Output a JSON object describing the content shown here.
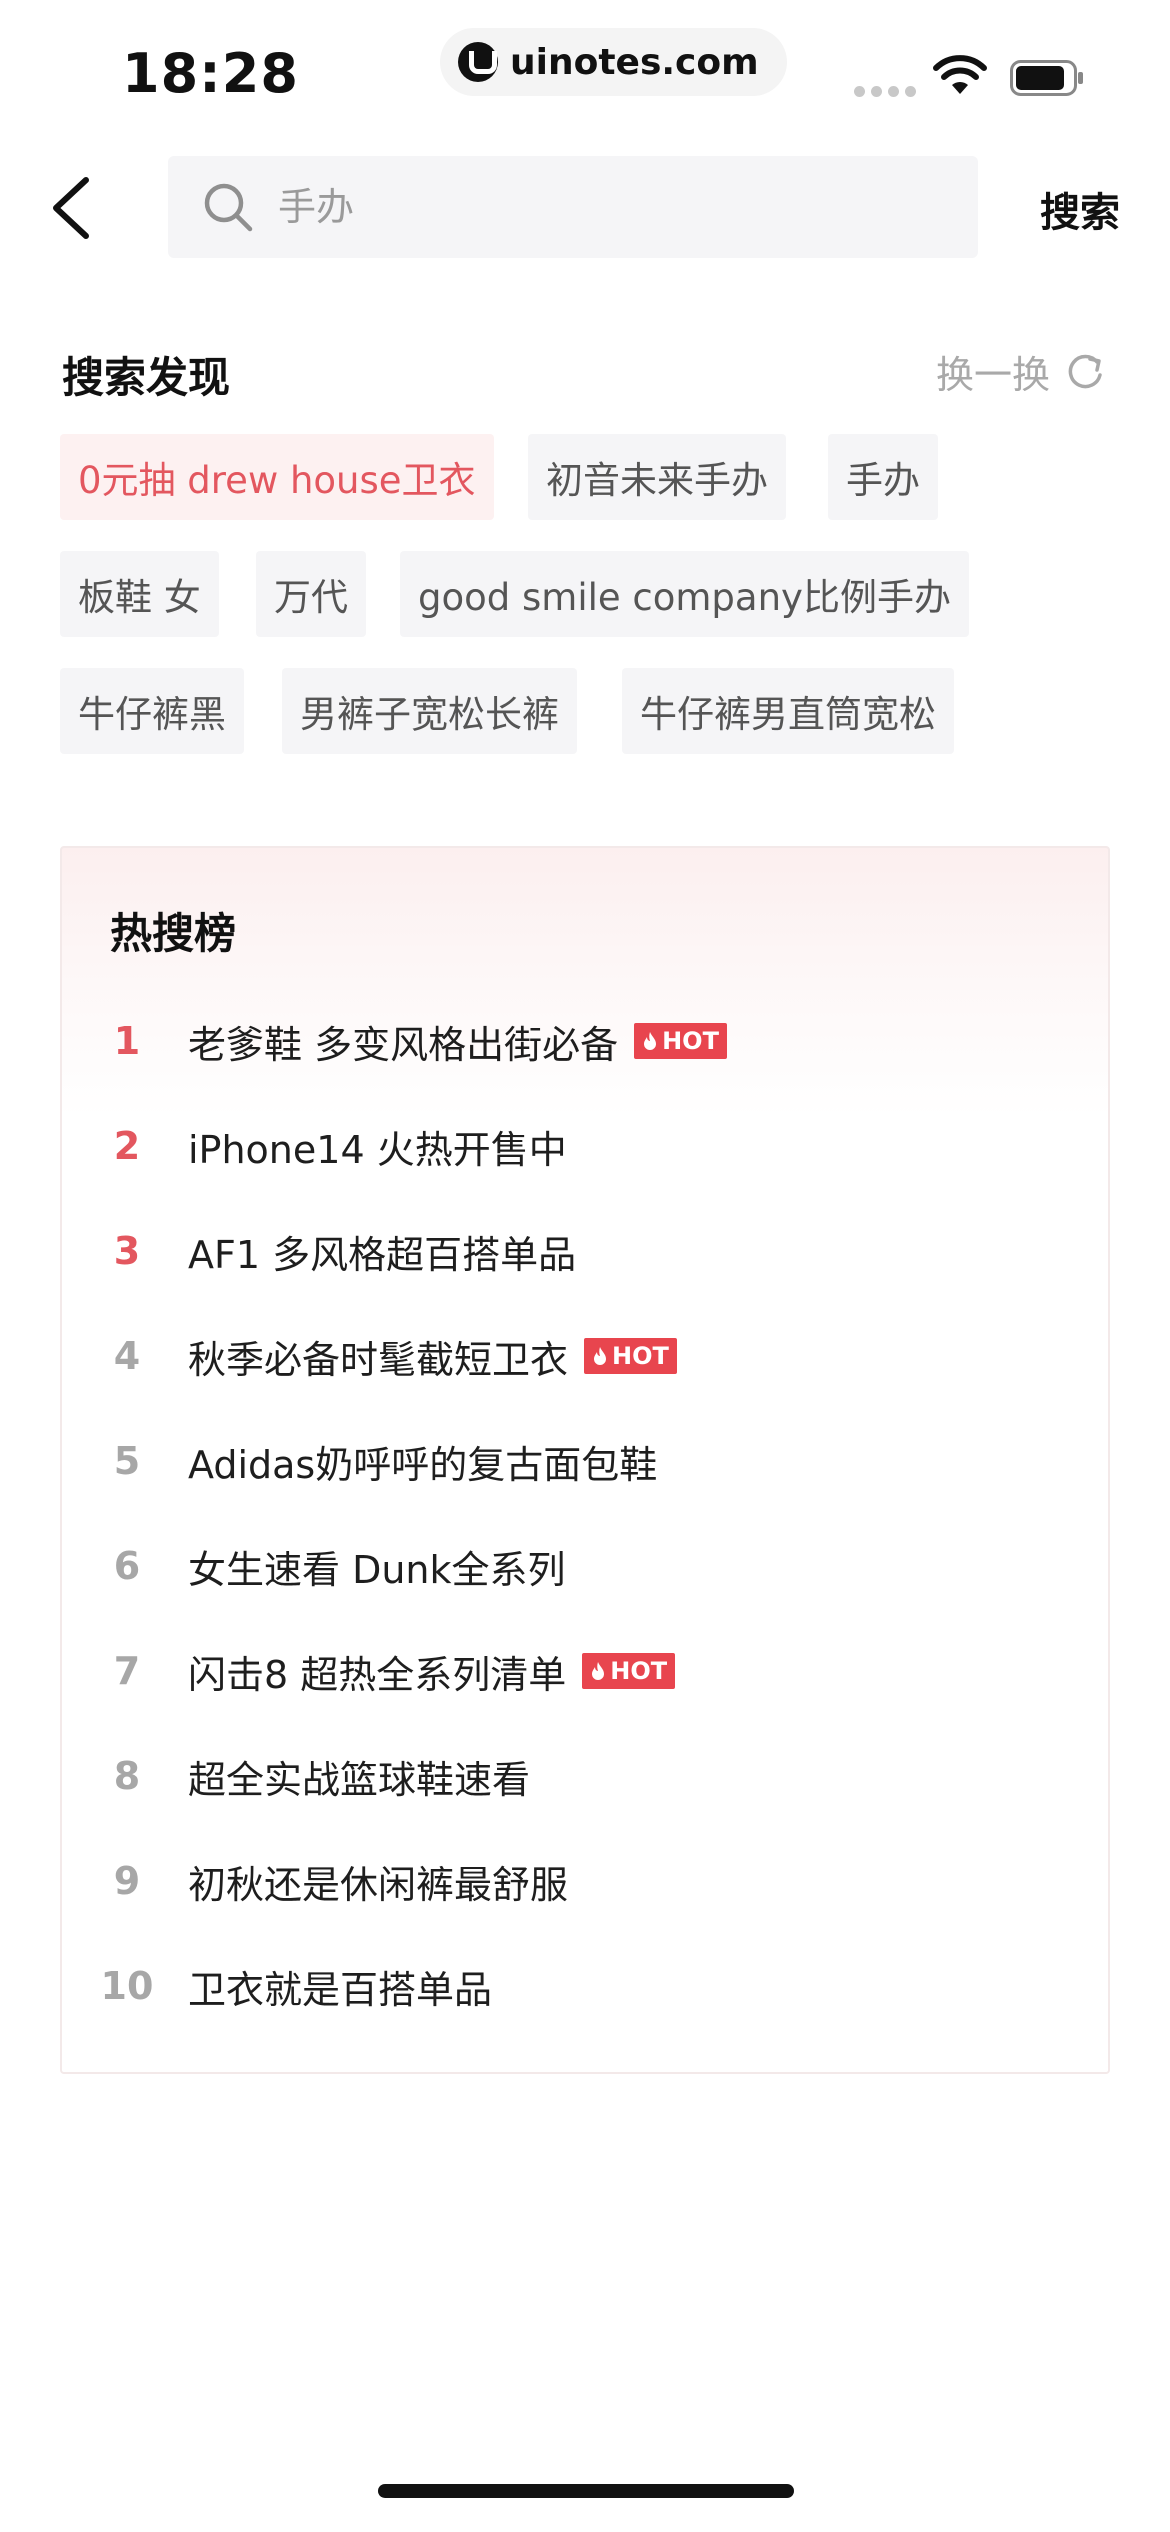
{
  "status_bar": {
    "time": "18:28",
    "watermark": "uinotes.com"
  },
  "search": {
    "placeholder": "手办",
    "value": "",
    "button_label": "搜索"
  },
  "discover": {
    "title": "搜索发现",
    "refresh_label": "换一换",
    "tags": [
      "0元抽 drew house卫衣",
      "初音未来手办",
      "手办",
      "板鞋 女",
      "万代",
      "good smile company比例手办",
      "牛仔裤黑",
      "男裤子宽松长裤",
      "牛仔裤男直筒宽松"
    ],
    "highlight_color": "#e3575f"
  },
  "hot_list": {
    "title": "热搜榜",
    "badge_label": "HOT",
    "accent_color": "#e8454e",
    "items": [
      {
        "rank": "1",
        "text": "老爹鞋 多变风格出街必备",
        "hot": true
      },
      {
        "rank": "2",
        "text": "iPhone14 火热开售中",
        "hot": false
      },
      {
        "rank": "3",
        "text": "AF1 多风格超百搭单品",
        "hot": false
      },
      {
        "rank": "4",
        "text": "秋季必备时髦截短卫衣",
        "hot": true
      },
      {
        "rank": "5",
        "text": "Adidas奶呼呼的复古面包鞋",
        "hot": false
      },
      {
        "rank": "6",
        "text": "女生速看 Dunk全系列",
        "hot": false
      },
      {
        "rank": "7",
        "text": "闪击8 超热全系列清单",
        "hot": true
      },
      {
        "rank": "8",
        "text": "超全实战篮球鞋速看",
        "hot": false
      },
      {
        "rank": "9",
        "text": "初秋还是休闲裤最舒服",
        "hot": false
      },
      {
        "rank": "10",
        "text": "卫衣就是百搭单品",
        "hot": false
      }
    ]
  },
  "icons": {
    "back": "chevron-left-icon",
    "search": "search-icon",
    "refresh": "refresh-icon",
    "hot": "flame-icon"
  }
}
